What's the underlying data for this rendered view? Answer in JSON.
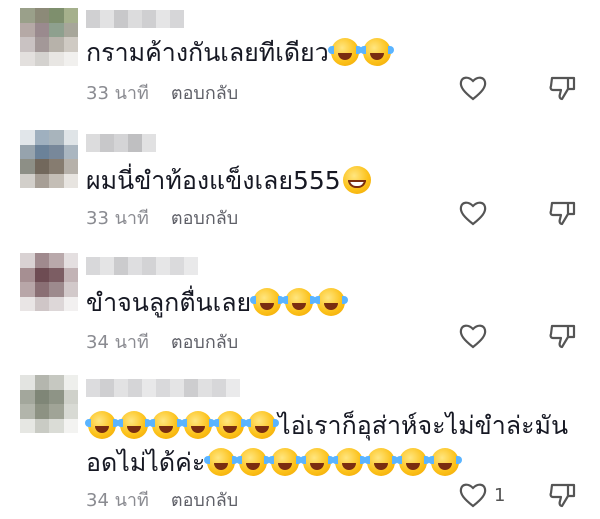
{
  "comments": [
    {
      "text": "กรามค้างกันเลยทีเดียว",
      "emojis": [
        "tears-of-joy",
        "tears-of-joy"
      ],
      "time": "33 นาที",
      "reply": "ตอบกลับ",
      "likes": ""
    },
    {
      "text": "ผมนี่ขำท้องแข็งเลย555",
      "emojis": [
        "grinning"
      ],
      "time": "33 นาที",
      "reply": "ตอบกลับ",
      "likes": ""
    },
    {
      "text": "ขำจนลูกตื่นเลย",
      "emojis": [
        "tears-of-joy",
        "tears-of-joy",
        "tears-of-joy"
      ],
      "time": "34 นาที",
      "reply": "ตอบกลับ",
      "likes": ""
    },
    {
      "line1": "ไอ่เราก็อุส่าห์จะไม่ขำล่ะมัน",
      "line2": "อดไม่ได้ค่ะ",
      "emojis_before": 6,
      "emojis_after": 8,
      "time": "34 นาที",
      "reply": "ตอบกลับ",
      "likes": "1"
    }
  ],
  "icons": {
    "like": "heart-outline-icon",
    "dislike": "thumbs-down-outline-icon"
  }
}
